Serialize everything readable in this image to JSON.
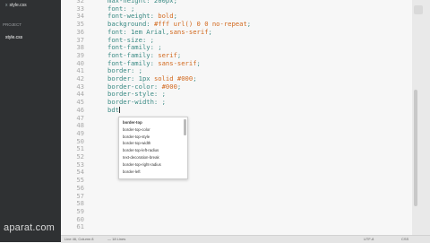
{
  "sidebar": {
    "open_file": "style.css",
    "close_glyph": "x",
    "group_label": "PROJECT",
    "item": "style.css"
  },
  "watermark": "aparat.com",
  "editor": {
    "lines": [
      {
        "n": "32",
        "parts": [
          {
            "t": "max-height: 200px;",
            "c": "prop"
          }
        ]
      },
      {
        "n": "33",
        "parts": [
          {
            "t": "font: ;",
            "c": "prop"
          }
        ]
      },
      {
        "n": "34",
        "parts": [
          {
            "t": "font-weight: ",
            "c": "prop"
          },
          {
            "t": "bold",
            "c": "val"
          },
          {
            "t": ";",
            "c": "prop"
          }
        ]
      },
      {
        "n": "35",
        "parts": [
          {
            "t": "background: ",
            "c": "prop"
          },
          {
            "t": "#fff url() 0 0 no-repeat",
            "c": "val"
          },
          {
            "t": ";",
            "c": "prop"
          }
        ]
      },
      {
        "n": "36",
        "parts": [
          {
            "t": "font: 1em Arial,",
            "c": "prop"
          },
          {
            "t": "sans-serif",
            "c": "val"
          },
          {
            "t": ";",
            "c": "prop"
          }
        ]
      },
      {
        "n": "37",
        "parts": [
          {
            "t": "font-size: ;",
            "c": "prop"
          }
        ]
      },
      {
        "n": "38",
        "parts": [
          {
            "t": "font-family: ;",
            "c": "prop"
          }
        ]
      },
      {
        "n": "39",
        "parts": [
          {
            "t": "font-family: ",
            "c": "prop"
          },
          {
            "t": "serif",
            "c": "val"
          },
          {
            "t": ";",
            "c": "prop"
          }
        ]
      },
      {
        "n": "40",
        "parts": [
          {
            "t": "font-family: ",
            "c": "prop"
          },
          {
            "t": "sans-serif",
            "c": "val"
          },
          {
            "t": ";",
            "c": "prop"
          }
        ]
      },
      {
        "n": "41",
        "parts": [
          {
            "t": "border: ;",
            "c": "prop"
          }
        ]
      },
      {
        "n": "42",
        "parts": [
          {
            "t": "border: 1px ",
            "c": "prop"
          },
          {
            "t": "solid #000",
            "c": "val"
          },
          {
            "t": ";",
            "c": "prop"
          }
        ]
      },
      {
        "n": "43",
        "parts": [
          {
            "t": "border-color: ",
            "c": "prop"
          },
          {
            "t": "#000",
            "c": "val"
          },
          {
            "t": ";",
            "c": "prop"
          }
        ]
      },
      {
        "n": "44",
        "parts": [
          {
            "t": "border-style: ;",
            "c": "prop"
          }
        ]
      },
      {
        "n": "45",
        "parts": [
          {
            "t": "border-width: ;",
            "c": "prop"
          }
        ]
      },
      {
        "n": "46",
        "parts": [
          {
            "t": "bdt",
            "c": "typed"
          }
        ],
        "cursor": true
      },
      {
        "n": "47",
        "parts": []
      },
      {
        "n": "48",
        "parts": []
      },
      {
        "n": "49",
        "parts": []
      },
      {
        "n": "50",
        "parts": []
      },
      {
        "n": "51",
        "parts": []
      },
      {
        "n": "52",
        "parts": []
      },
      {
        "n": "53",
        "parts": []
      },
      {
        "n": "54",
        "parts": []
      },
      {
        "n": "55",
        "parts": []
      },
      {
        "n": "56",
        "parts": []
      },
      {
        "n": "57",
        "parts": []
      },
      {
        "n": "58",
        "parts": []
      },
      {
        "n": "59",
        "parts": []
      },
      {
        "n": "60",
        "parts": []
      },
      {
        "n": "61",
        "parts": []
      }
    ]
  },
  "autocomplete": {
    "items": [
      "border-top",
      "border-top-color",
      "border-top-style",
      "border-top-width",
      "border-top-left-radius",
      "text-decoration-break",
      "border-top-right-radius",
      "border-left"
    ],
    "selected_index": 0
  },
  "status": {
    "position": "Line 46, Column 8",
    "misc": "— 18 Lines",
    "encoding": "UTF-8",
    "language": "CSS"
  }
}
